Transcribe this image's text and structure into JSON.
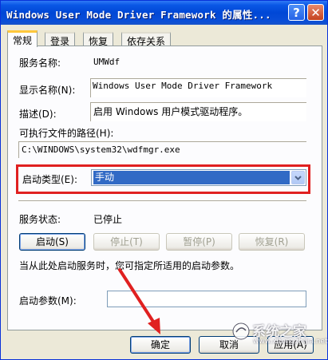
{
  "window": {
    "title": "Windows User Mode Driver Framework 的属性...",
    "help_button": "?",
    "close_button": "✕"
  },
  "tabs": [
    {
      "label": "常规",
      "active": true
    },
    {
      "label": "登录",
      "active": false
    },
    {
      "label": "恢复",
      "active": false
    },
    {
      "label": "依存关系",
      "active": false
    }
  ],
  "general": {
    "service_name_label": "服务名称:",
    "service_name_value": "UMWdf",
    "display_name_label": "显示名称(N):",
    "display_name_value": "Windows User Mode Driver Framework",
    "description_label": "描述(D):",
    "description_value": "启用 Windows 用户模式驱动程序。",
    "exe_path_label": "可执行文件的路径(H):",
    "exe_path_value": "C:\\WINDOWS\\system32\\wdfmgr.exe",
    "startup_type_label": "启动类型(E):",
    "startup_type_value": "手动",
    "service_status_label": "服务状态:",
    "service_status_value": "已停止",
    "start_button": "启动(S)",
    "stop_button": "停止(T)",
    "pause_button": "暂停(P)",
    "resume_button": "恢复(R)",
    "hint_text": "当从此处启动服务时，您可指定所适用的启动参数。",
    "start_params_label": "启动参数(M):",
    "start_params_value": ""
  },
  "footer": {
    "ok_button": "确定",
    "cancel_button": "取消",
    "apply_button": "应用(A)"
  },
  "watermark": {
    "text": "系统之家",
    "sub": "www.xitongzhijia.net"
  },
  "colors": {
    "highlight_box": "#e02020",
    "selection": "#316ac5",
    "title_bar": "#0047d6"
  }
}
